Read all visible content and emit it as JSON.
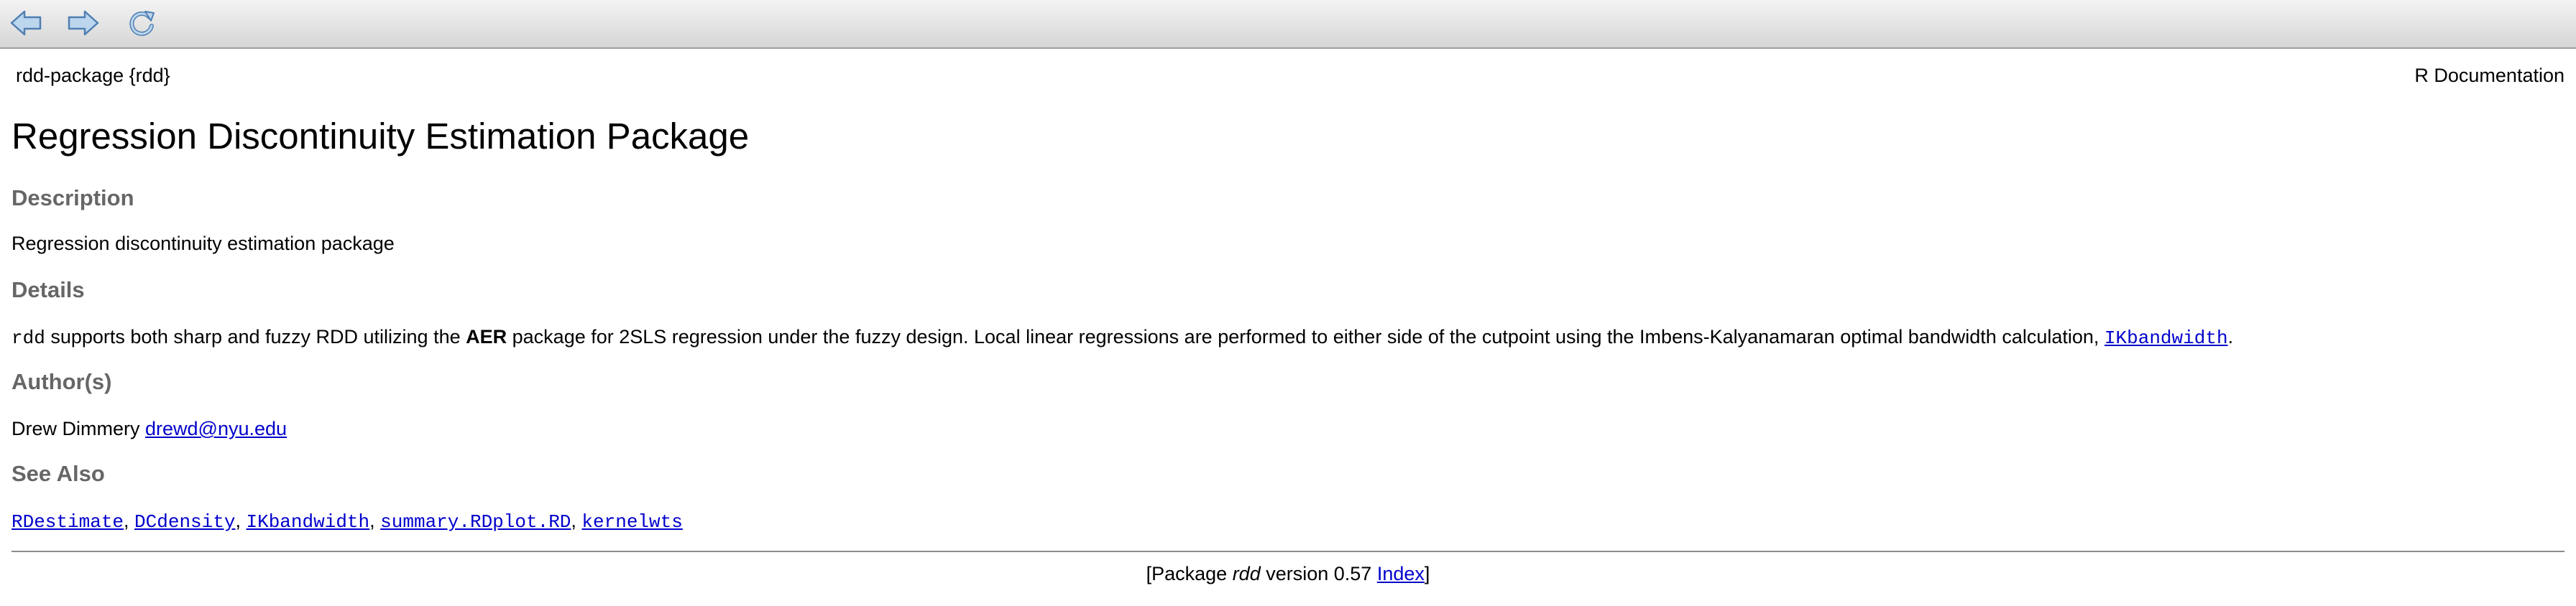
{
  "toolbar": {
    "back_icon": "back-arrow-icon",
    "forward_icon": "forward-arrow-icon",
    "reload_icon": "reload-icon"
  },
  "header": {
    "topic": "rdd-package {rdd}",
    "doc_type": "R Documentation"
  },
  "title": "Regression Discontinuity Estimation Package",
  "sections": {
    "description": {
      "heading": "Description",
      "text": "Regression discontinuity estimation package"
    },
    "details": {
      "heading": "Details",
      "code_rdd": "rdd",
      "text_1": " supports both sharp and fuzzy RDD utilizing the ",
      "bold_aer": "AER",
      "text_2": " package for 2SLS regression under the fuzzy design. Local linear regressions are performed to either side of the cutpoint using the Imbens-Kalyanamaran optimal bandwidth calculation, ",
      "link_ikbandwidth": "IKbandwidth",
      "text_3": "."
    },
    "authors": {
      "heading": "Author(s)",
      "name": "Drew Dimmery",
      "email": "drewd@nyu.edu"
    },
    "see_also": {
      "heading": "See Also",
      "links": [
        "RDestimate",
        "DCdensity",
        "IKbandwidth",
        "summary.RDplot.RD",
        "kernelwts"
      ],
      "separator": ", "
    }
  },
  "footer": {
    "prefix": "[Package ",
    "package_name": "rdd",
    "version_text": " version 0.57 ",
    "index_link": "Index",
    "suffix": "]"
  },
  "colors": {
    "link": "#0000cc",
    "heading": "#666666",
    "toolbar_top": "#f3f3f3",
    "toolbar_bottom": "#d6d6d6"
  }
}
